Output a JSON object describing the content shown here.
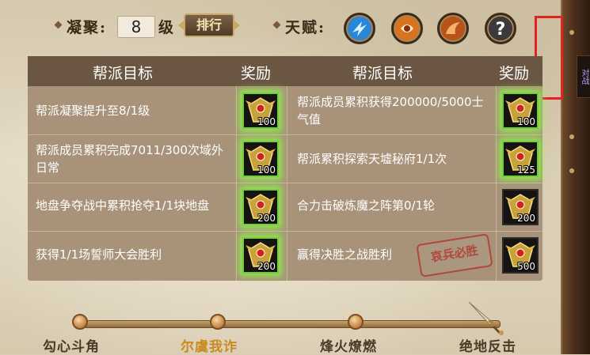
{
  "header": {
    "cohesion_label": "凝聚:",
    "cohesion_level": "8",
    "level_unit": "级",
    "rank_button": "排行",
    "talent_label": "天赋:",
    "talent_icons": [
      "blue-lightning-talent-icon",
      "orange-swirl-talent-icon",
      "orange-claw-talent-icon",
      "question-mark-icon"
    ]
  },
  "side_tab_text": "对战",
  "table": {
    "headers": [
      "帮派目标",
      "奖励",
      "帮派目标",
      "奖励"
    ],
    "left": [
      {
        "goal": "帮派凝聚提升至8/1级",
        "reward_qty": "100",
        "glow": true
      },
      {
        "goal": "帮派成员累积完成7011/300次域外日常",
        "reward_qty": "100",
        "glow": true
      },
      {
        "goal": "地盘争夺战中累积抢夺1/1块地盘",
        "reward_qty": "200",
        "glow": true
      },
      {
        "goal": "获得1/1场誓师大会胜利",
        "reward_qty": "200",
        "glow": true
      }
    ],
    "right": [
      {
        "goal": "帮派成员累积获得200000/5000士气值",
        "reward_qty": "100",
        "glow": true
      },
      {
        "goal": "帮派累积探索天墟秘府1/1次",
        "reward_qty": "125",
        "glow": true
      },
      {
        "goal": "合力击破炼魔之阵第0/1轮",
        "reward_qty": "200",
        "glow": false
      },
      {
        "goal": "赢得决胜之战胜利",
        "reward_qty": "500",
        "glow": false
      }
    ],
    "seal_text": "哀兵必胜"
  },
  "progress": {
    "stages": [
      "勾心斗角",
      "尔虞我诈",
      "烽火燎燃",
      "绝地反击"
    ],
    "active_stage": "尔虞我诈"
  },
  "colors": {
    "header_bg": "#6a5642",
    "table_bg": "#a8937a",
    "glow": "#8cff46",
    "active_stage": "#c98a1d",
    "highlight_box": "#e52222"
  }
}
